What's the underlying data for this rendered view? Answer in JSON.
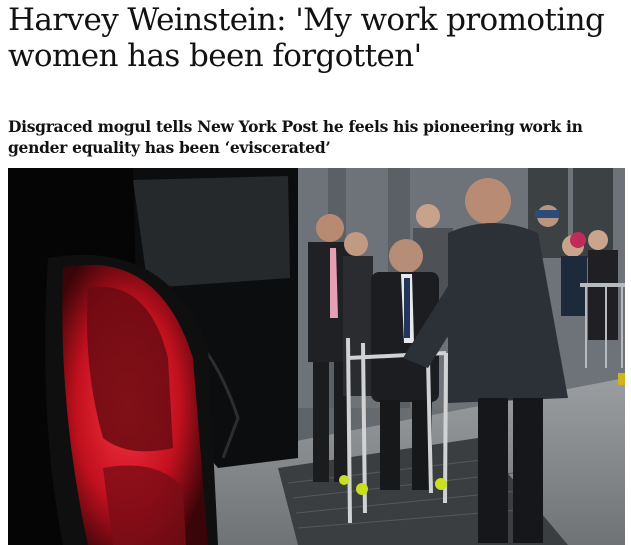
{
  "article": {
    "headline": "Harvey Weinstein: 'My work promoting women has been forgotten'",
    "standfirst": "Disgraced mogul tells New York Post he feels his pioneering work in gender equality has been ‘eviscerated’"
  },
  "photo": {
    "subject": "photo-courthouse-walker"
  },
  "colors": {
    "text": "#121212",
    "background": "#ffffff",
    "taillight": "#e0182a",
    "tennis_ball": "#c8e01e"
  }
}
